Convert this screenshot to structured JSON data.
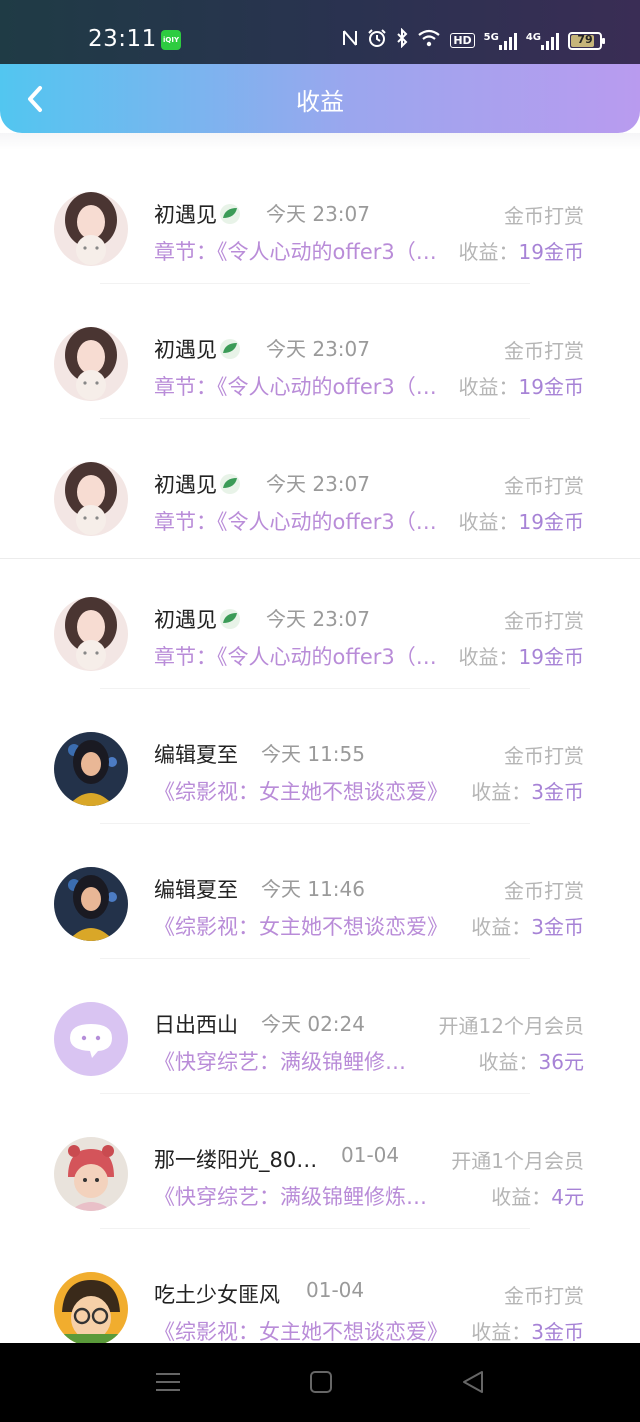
{
  "status_bar": {
    "time": "23:11",
    "app_badge": "iQIY",
    "hd_label": "HD",
    "net1": "5G",
    "net2": "4G",
    "battery": "79"
  },
  "header": {
    "title": "收益"
  },
  "rows": [
    {
      "name": "初遇见",
      "time": "今天 23:07",
      "type": "金币打赏",
      "chapter": "章节：《令人心动的offer3（…",
      "earn_label": "收益：",
      "earn_value": "19金币"
    },
    {
      "name": "初遇见",
      "time": "今天 23:07",
      "type": "金币打赏",
      "chapter": "章节：《令人心动的offer3（…",
      "earn_label": "收益：",
      "earn_value": "19金币"
    },
    {
      "name": "初遇见",
      "time": "今天 23:07",
      "type": "金币打赏",
      "chapter": "章节：《令人心动的offer3（…",
      "earn_label": "收益：",
      "earn_value": "19金币"
    },
    {
      "name": "初遇见",
      "time": "今天 23:07",
      "type": "金币打赏",
      "chapter": "章节：《令人心动的offer3（…",
      "earn_label": "收益：",
      "earn_value": "19金币"
    },
    {
      "name": "编辑夏至",
      "time": "今天 11:55",
      "type": "金币打赏",
      "chapter": "《综影视：女主她不想谈恋爱》",
      "earn_label": "收益：",
      "earn_value": "3金币"
    },
    {
      "name": "编辑夏至",
      "time": "今天 11:46",
      "type": "金币打赏",
      "chapter": "《综影视：女主她不想谈恋爱》",
      "earn_label": "收益：",
      "earn_value": "3金币"
    },
    {
      "name": "日出西山",
      "time": "今天 02:24",
      "type": "开通12个月会员",
      "chapter": "《快穿综艺：满级锦鲤修…",
      "earn_label": "收益：",
      "earn_value": "36元"
    },
    {
      "name": "那一缕阳光_80…",
      "time": "01-04",
      "type": "开通1个月会员",
      "chapter": "《快穿综艺：满级锦鲤修炼…",
      "earn_label": "收益：",
      "earn_value": "4元"
    },
    {
      "name": "吃土少女匪风",
      "time": "01-04",
      "type": "金币打赏",
      "chapter": "《综影视：女主她不想谈恋爱》",
      "earn_label": "收益：",
      "earn_value": "3金币"
    }
  ]
}
